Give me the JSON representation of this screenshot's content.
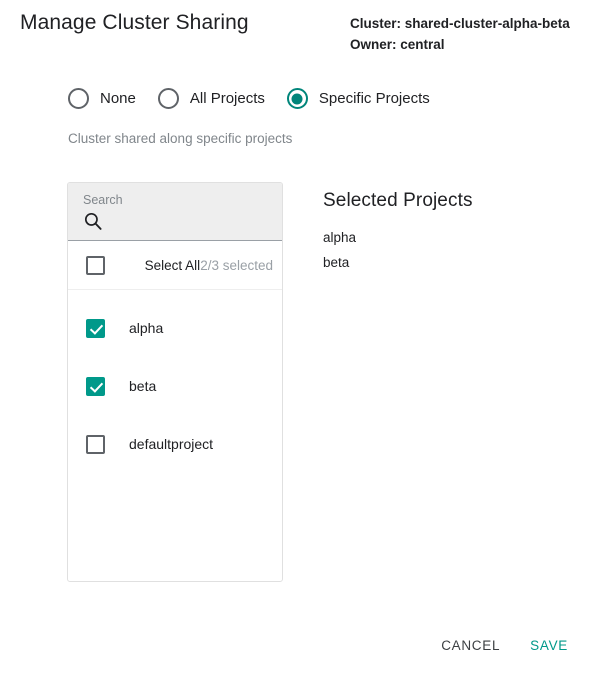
{
  "header": {
    "title": "Manage Cluster Sharing",
    "cluster_line": "Cluster: shared-cluster-alpha-beta",
    "owner_line": "Owner: central"
  },
  "sharing_mode": {
    "options": [
      {
        "label": "None",
        "selected": false
      },
      {
        "label": "All Projects",
        "selected": false
      },
      {
        "label": "Specific Projects",
        "selected": true
      }
    ],
    "hint": "Cluster shared along specific projects"
  },
  "project_picker": {
    "search": {
      "placeholder": "Search",
      "value": "",
      "icon": "search-icon"
    },
    "select_all": {
      "label": "Select All",
      "count_text": "2/3 selected",
      "checked": false
    },
    "projects": [
      {
        "name": "alpha",
        "checked": true
      },
      {
        "name": "beta",
        "checked": true
      },
      {
        "name": "defaultproject",
        "checked": false
      }
    ]
  },
  "selected_panel": {
    "title": "Selected Projects",
    "items": [
      "alpha",
      "beta"
    ]
  },
  "footer": {
    "cancel_label": "CANCEL",
    "save_label": "SAVE"
  },
  "colors": {
    "accent": "#00998A",
    "radio_accent": "#00857A",
    "muted_text": "#80868b",
    "search_bg": "#eeeeee"
  }
}
